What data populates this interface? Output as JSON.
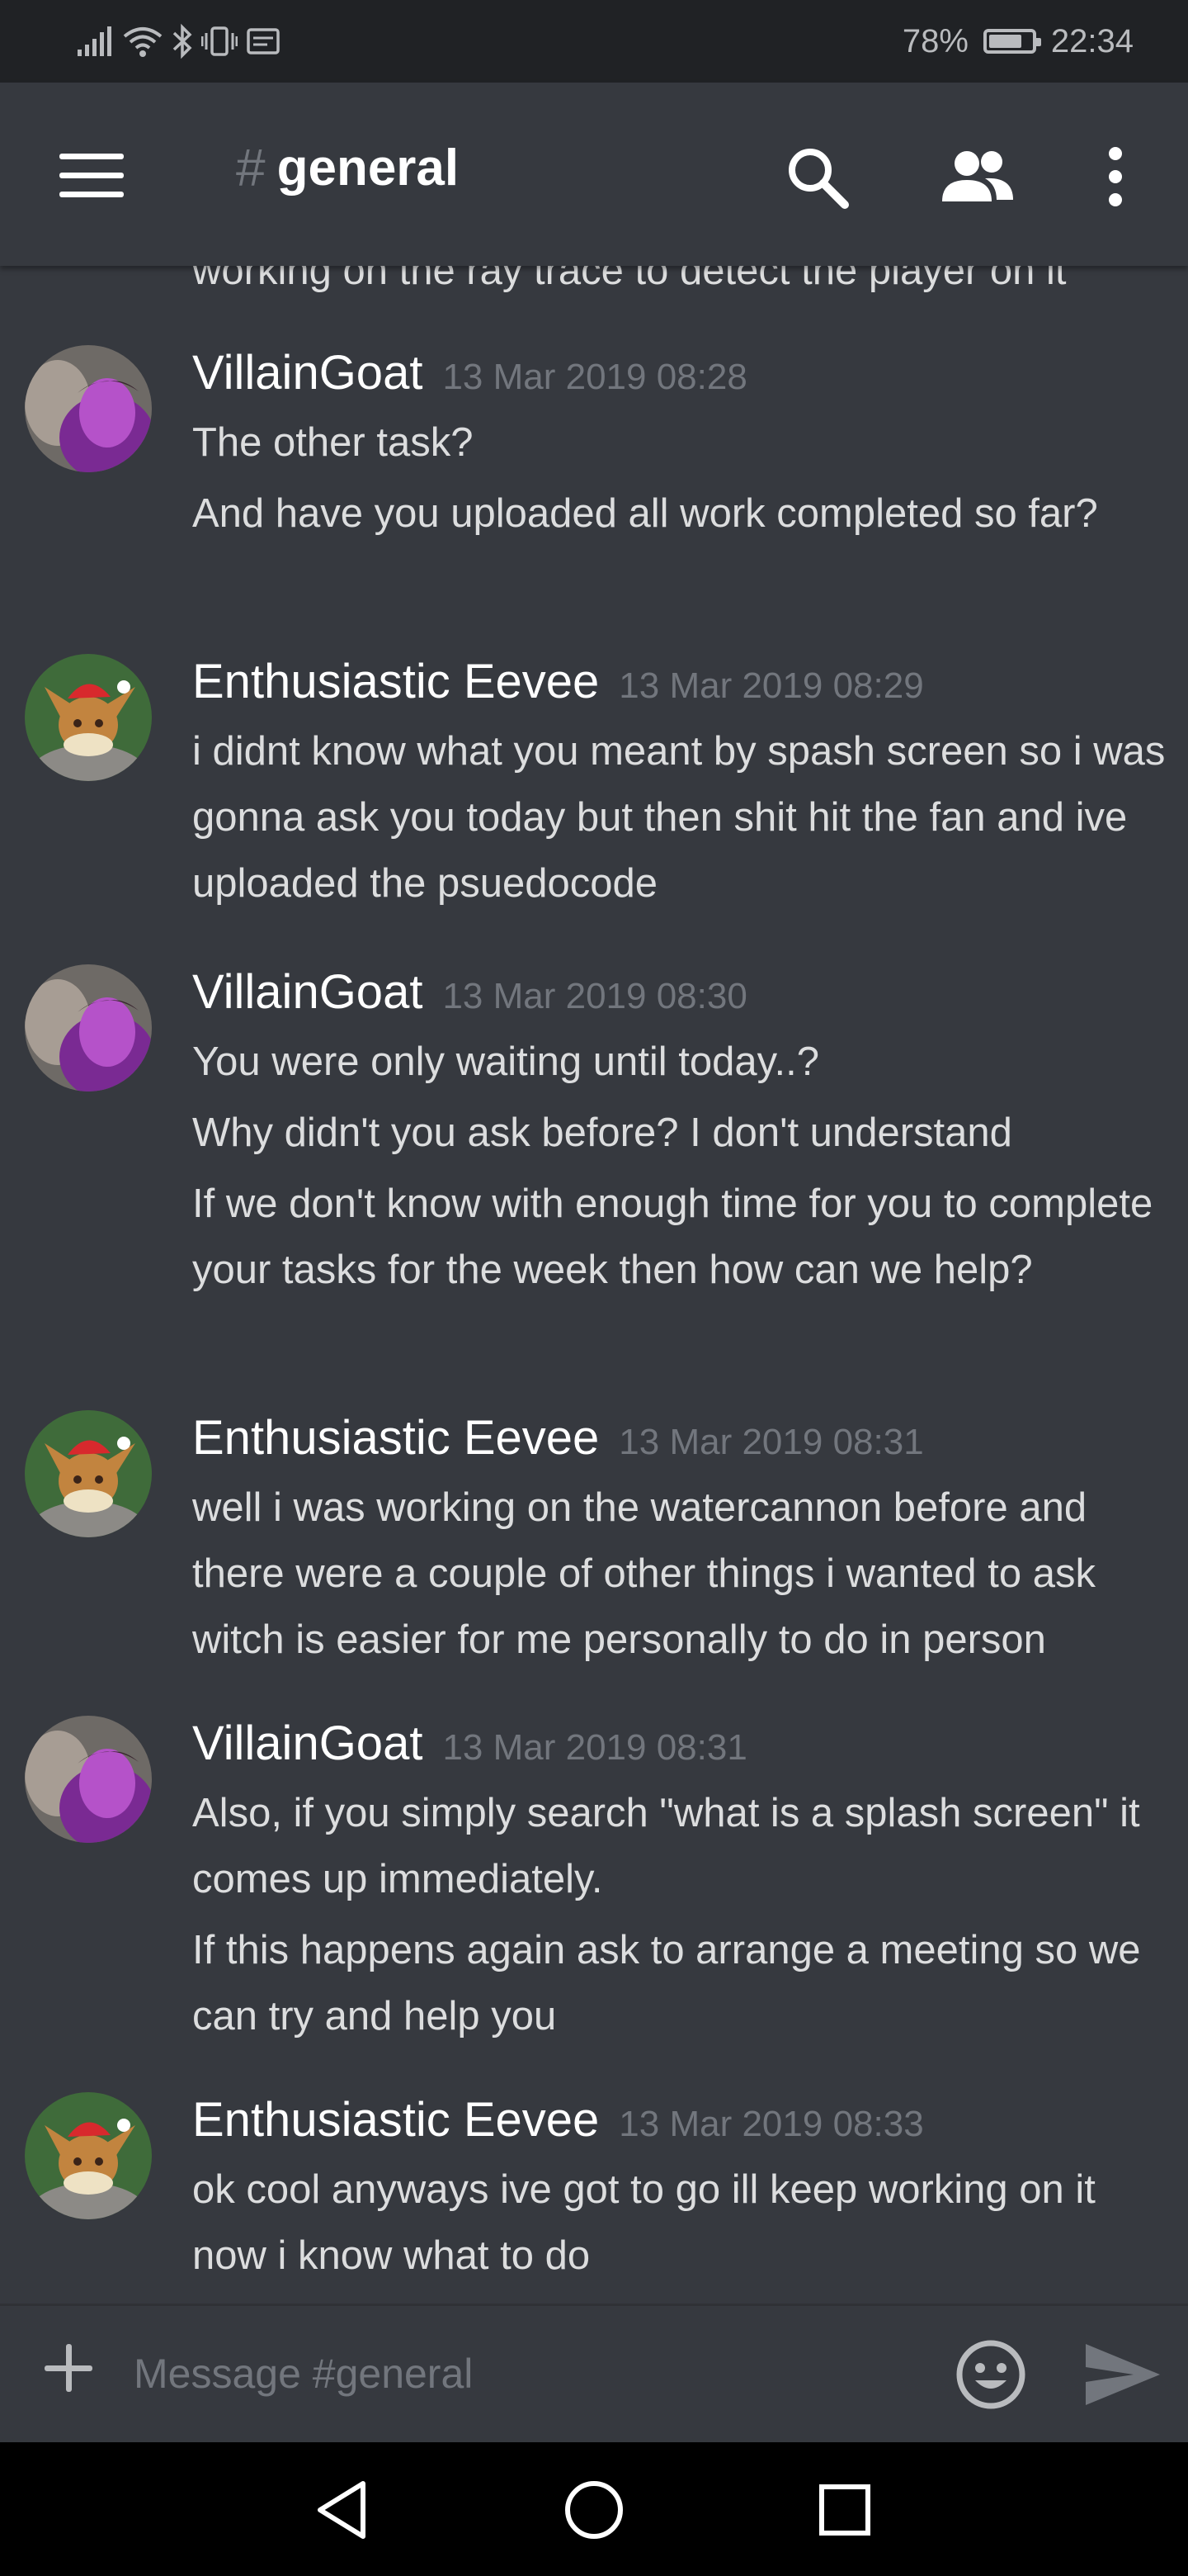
{
  "status_bar": {
    "battery": "78%",
    "battery_level": 0.78,
    "time": "22:34"
  },
  "header": {
    "channel_hash": "#",
    "channel_name": "general",
    "icons": [
      "menu-icon",
      "search-icon",
      "members-icon",
      "more-vertical-icon"
    ]
  },
  "messages": {
    "cut_off_text": "working on the ray trace to detect the player on it",
    "items": [
      {
        "author": "VillainGoat",
        "timestamp": "13 Mar 2019 08:28",
        "lines": [
          "The other task?",
          "And have you uploaded all work completed so far?"
        ]
      },
      {
        "author": "Enthusiastic Eevee",
        "timestamp": "13 Mar 2019 08:29",
        "lines": [
          "i didnt know what you meant by spash screen so i was gonna ask you today but then shit hit the fan and ive uploaded the psuedocode"
        ]
      },
      {
        "author": "VillainGoat",
        "timestamp": "13 Mar 2019 08:30",
        "lines": [
          "You were only waiting until today..?",
          "Why didn't you ask before? I don't understand",
          "If we don't know with enough time for you to complete your tasks for the week then how can we help?"
        ]
      },
      {
        "author": "Enthusiastic Eevee",
        "timestamp": "13 Mar 2019 08:31",
        "lines": [
          "well i was working on the watercannon before and there were a couple of other things i wanted to ask witch is easier for me personally to do in person"
        ]
      },
      {
        "author": "VillainGoat",
        "timestamp": "13 Mar 2019 08:31",
        "lines": [
          "Also, if you simply search \"what is a splash screen\" it comes up immediately.",
          "If this happens again ask to arrange a meeting so we can try and help you"
        ]
      },
      {
        "author": "Enthusiastic Eevee",
        "timestamp": "13 Mar 2019 08:33",
        "lines": [
          "ok cool anyways ive got to go ill keep working on it now i know what to do"
        ]
      }
    ]
  },
  "composer": {
    "placeholder": "Message #general"
  },
  "colors": {
    "background": "#36393f",
    "status_bar": "#202225",
    "username": "#ffffff",
    "timestamp": "#72767d",
    "text": "#dcddde"
  }
}
